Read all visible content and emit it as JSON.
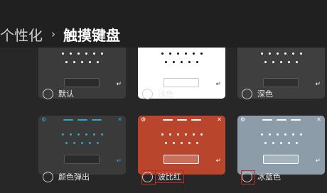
{
  "breadcrumb": {
    "parent": "个性化",
    "separator": "›",
    "current": "触摸键盘"
  },
  "enter_key_glyph": "↵",
  "themes": [
    {
      "id": "default",
      "label": "默认",
      "colors": {
        "bg": "#3b3b3b",
        "key": "#2b2b2b",
        "key_border": "#5a5a5a",
        "dot": "#ffffff"
      },
      "titlebar": false
    },
    {
      "id": "light",
      "label": "浅色",
      "colors": {
        "bg": "#ffffff",
        "key": "#ffffff",
        "key_border": "#c8c8c8",
        "dot": "#111111"
      },
      "titlebar": false
    },
    {
      "id": "dark",
      "label": "深色",
      "colors": {
        "bg": "#3f3f3f",
        "key": "#2f2f2f",
        "key_border": "#575757",
        "dot": "#ffffff"
      },
      "titlebar": false
    },
    {
      "id": "color-pop",
      "label": "颜色弹出",
      "colors": {
        "bg": "#3a3a3a",
        "key": "#2b2b2b",
        "key_border": "#555555",
        "dot": "#2aa7c9",
        "accent": "#2aa7c9"
      },
      "titlebar": true
    },
    {
      "id": "scarlet",
      "label": "波比红",
      "colors": {
        "bg": "#b9452c",
        "key": "#c9705c",
        "key_border": "#ffffff",
        "dot": "#ffffff",
        "accent": "#ffffff"
      },
      "titlebar": true,
      "highlighted": true
    },
    {
      "id": "ice-blue",
      "label": "冰蓝色",
      "colors": {
        "bg": "#8c9da9",
        "key": "#a5b3bd",
        "key_border": "#ffffff",
        "dot": "#ffffff",
        "accent": "#ffffff"
      },
      "titlebar": true,
      "highlighted": true
    }
  ]
}
